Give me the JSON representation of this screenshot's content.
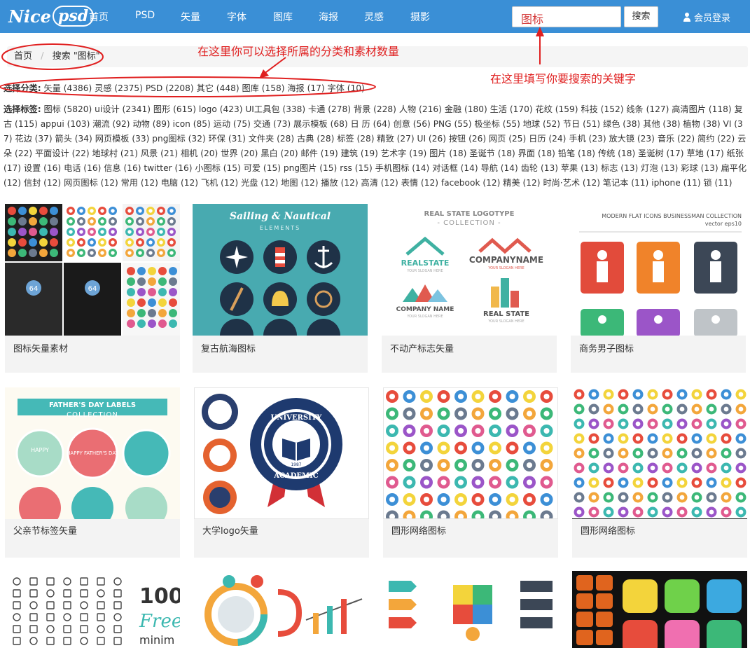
{
  "header": {
    "logo_prefix": "Nice",
    "logo_suffix": "psd",
    "nav": [
      "首页",
      "PSD",
      "矢量",
      "字体",
      "图库",
      "海报",
      "灵感",
      "摄影"
    ],
    "search_value": "图标",
    "search_button": "搜索",
    "login": "会员登录"
  },
  "breadcrumb": {
    "home": "首页",
    "current": "搜索 \"图标\""
  },
  "annotations": {
    "category_hint": "在这里你可以选择所属的分类和素材数量",
    "keyword_hint": "在这里填写你要搜索的关键字"
  },
  "categories": {
    "label": "选择分类:",
    "items": [
      "矢量 (4386)",
      "灵感 (2375)",
      "PSD (2208)",
      "其它 (448)",
      "图库 (158)",
      "海报 (17)",
      "字体 (10)"
    ]
  },
  "tags": {
    "label": "选择标签:",
    "items": [
      "图标 (5820)",
      "ui设计 (2341)",
      "图形 (615)",
      "logo (423)",
      "UI工具包 (338)",
      "卡通 (278)",
      "背景 (228)",
      "人物 (216)",
      "金融 (180)",
      "生活 (170)",
      "花纹 (159)",
      "科技 (152)",
      "线条 (127)",
      "高清图片 (118)",
      "复古 (115)",
      "appui (103)",
      "潮流 (92)",
      "动物 (89)",
      "icon (85)",
      "运动 (75)",
      "交通 (73)",
      "展示模板 (68)",
      "日 历 (64)",
      "创意 (56)",
      "PNG (55)",
      "极坐标 (55)",
      "地球 (52)",
      "节日 (51)",
      "绿色 (38)",
      "其他 (38)",
      "植物 (38)",
      "VI (37)",
      "花边 (37)",
      "箭头 (34)",
      "网页模板 (33)",
      "png图标 (32)",
      "环保 (31)",
      "文件夹 (28)",
      "古典 (28)",
      "标签 (28)",
      "精致 (27)",
      "UI (26)",
      "按钮 (26)",
      "网页 (25)",
      "日历 (24)",
      "手机 (23)",
      "放大镜 (23)",
      "音乐 (22)",
      "简约 (22)",
      "云朵 (22)",
      "平面设计 (22)",
      "地球村 (21)",
      "风景 (21)",
      "相机 (20)",
      "世界 (20)",
      "黑白 (20)",
      "邮件 (19)",
      "建筑 (19)",
      "艺术字 (19)",
      "图片 (18)",
      "圣诞节 (18)",
      "界面 (18)",
      "铅笔 (18)",
      "传统 (18)",
      "圣诞树 (17)",
      "草地 (17)",
      "纸张 (17)",
      "设置 (16)",
      "电话 (16)",
      "信息 (16)",
      "twitter (16)",
      "小图标 (15)",
      "可爱 (15)",
      "png图片 (15)",
      "rss (15)",
      "手机图标 (14)",
      "对话框 (14)",
      "导航 (14)",
      "齿轮 (13)",
      "苹果 (13)",
      "标志 (13)",
      "灯泡 (13)",
      "彩球 (13)",
      "扁平化 (12)",
      "信封 (12)",
      "网页图标 (12)",
      "常用 (12)",
      "电脑 (12)",
      "飞机 (12)",
      "光盘 (12)",
      "地图 (12)",
      "播放 (12)",
      "高清 (12)",
      "表情 (12)",
      "facebook (12)",
      "精美 (12)",
      "时尚·艺术 (12)",
      "笔记本 (11)",
      "iphone (11)",
      "锁 (11)"
    ]
  },
  "cards": [
    {
      "title": "图标矢量素材"
    },
    {
      "title": "复古航海图标",
      "thumb_heading": "Sailing & Nautical",
      "thumb_sub": "ELEMENTS"
    },
    {
      "title": "不动产标志矢量",
      "thumb_heading": "REAL STATE LOGOTYPE",
      "thumb_sub": "- COLLECTION -",
      "logo_a": "REALSTATE",
      "logo_b": "COMPANYNAME",
      "logo_c": "COMPANY NAME",
      "logo_d": "REAL STATE",
      "slogan": "YOUR SLOGAN HERE"
    },
    {
      "title": "商务男子图标",
      "thumb_heading": "MODERN FLAT ICONS BUSINESSMAN COLLECTION",
      "thumb_sub": "vector eps10"
    },
    {
      "title": "父亲节标签矢量",
      "thumb_heading": "FATHER'S DAY LABELS",
      "thumb_sub": "COLLECTION",
      "badge": "HAPPY",
      "badge2": "HAPPY FATHER'S DAY"
    },
    {
      "title": "大学logo矢量",
      "seal_top": "UNIVERSITY",
      "seal_bottom": "ACADEMIC",
      "seal_year": "1987"
    },
    {
      "title": "圆形网络图标"
    },
    {
      "title": "圆形网络图标"
    },
    {
      "title": "",
      "thumb_heading": "100",
      "thumb_sub": "Free",
      "thumb_sub2": "minim"
    },
    {
      "title": ""
    },
    {
      "title": ""
    },
    {
      "title": ""
    }
  ],
  "colors": {
    "nav_bg": "#3a8fd6",
    "annotation": "#e02020",
    "card_bg": "#f3f3f3"
  }
}
